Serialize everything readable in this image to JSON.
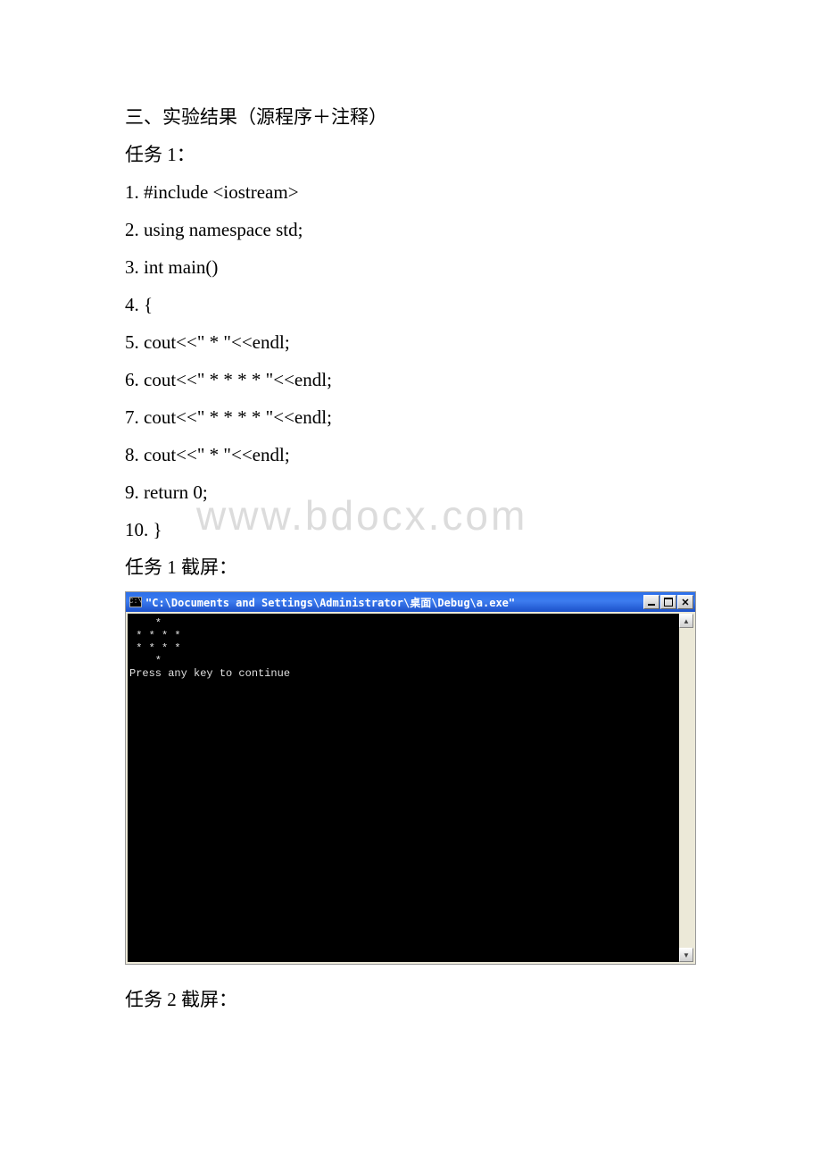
{
  "watermark": "www.bdocx.com",
  "heading": "三、实验结果（源程序＋注释）",
  "task1_label": "任务 1：",
  "code_lines": [
    "1. #include <iostream>",
    "2. using namespace std;",
    "3. int main()",
    "4. {",
    "5. cout<<\" * \"<<endl;",
    "6. cout<<\" * * * * \"<<endl;",
    "7. cout<<\" * * * * \"<<endl;",
    "8. cout<<\" * \"<<endl;",
    "9. return 0;",
    "10. }"
  ],
  "task1_screenshot_label": "任务 1 截屏：",
  "console_icon_text": "C:\\",
  "console_title": "\"C:\\Documents and Settings\\Administrator\\桌面\\Debug\\a.exe\"",
  "console_output": "    *\n * * * *\n * * * *\n    *\nPress any key to continue",
  "scroll_up": "▲",
  "scroll_down": "▼",
  "close_glyph": "✕",
  "task2_screenshot_label": "任务 2 截屏："
}
